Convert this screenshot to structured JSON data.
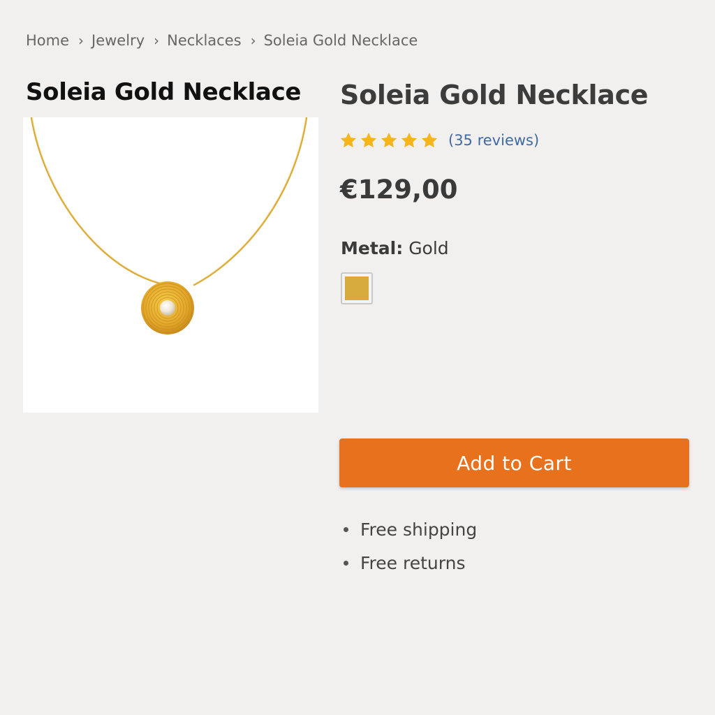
{
  "breadcrumb": {
    "items": [
      {
        "label": "Home"
      },
      {
        "label": "Jewelry"
      },
      {
        "label": "Necklaces"
      },
      {
        "label": "Soleia Gold Necklace"
      }
    ],
    "separator": "›"
  },
  "image": {
    "title": "Soleia Gold Necklace"
  },
  "product": {
    "title": "Soleia Gold Necklace",
    "rating": {
      "stars": 5,
      "max_stars": 5,
      "star_icon": "star-icon",
      "star_color": "#f5b51b",
      "reviews_label": "(35 reviews)"
    },
    "price": "€129,00",
    "metal": {
      "label": "Metal:",
      "value": "Gold",
      "swatch_color": "#d8ab3d"
    },
    "add_to_cart_label": "Add to Cart",
    "benefits": [
      {
        "label": "Free shipping"
      },
      {
        "label": "Free returns"
      }
    ]
  },
  "colors": {
    "accent": "#e8711d",
    "link": "#3f6aa3",
    "background": "#f1f0ef"
  }
}
